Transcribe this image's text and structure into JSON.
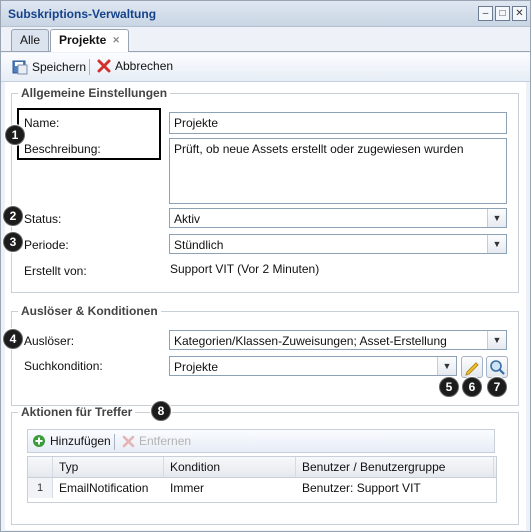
{
  "window": {
    "title": "Subskriptions-Verwaltung"
  },
  "tabs": [
    {
      "label": "Alle"
    },
    {
      "label": "Projekte"
    }
  ],
  "toolbar": {
    "save_label": "Speichern",
    "cancel_label": "Abbrechen"
  },
  "general": {
    "legend": "Allgemeine Einstellungen",
    "name_label": "Name:",
    "name_value": "Projekte",
    "desc_label": "Beschreibung:",
    "desc_value": "Prüft, ob neue Assets erstellt oder zugewiesen wurden",
    "status_label": "Status:",
    "status_value": "Aktiv",
    "period_label": "Periode:",
    "period_value": "Stündlich",
    "created_label": "Erstellt von:",
    "created_value": "Support VIT (Vor 2 Minuten)"
  },
  "triggers": {
    "legend": "Auslöser & Konditionen",
    "trigger_label": "Auslöser:",
    "trigger_value": "Kategorien/Klassen-Zuweisungen; Asset-Erstellung",
    "search_label": "Suchkondition:",
    "search_value": "Projekte"
  },
  "actions": {
    "legend": "Aktionen für Treffer",
    "add_label": "Hinzufügen",
    "remove_label": "Entfernen",
    "columns": [
      "Typ",
      "Kondition",
      "Benutzer / Benutzergruppe"
    ],
    "rows": [
      {
        "num": "1",
        "typ": "EmailNotification",
        "kondition": "Immer",
        "benutzer": "Benutzer: Support VIT"
      }
    ]
  },
  "callouts": [
    "1",
    "2",
    "3",
    "4",
    "5",
    "6",
    "7",
    "8"
  ],
  "colors": {
    "title": "#15428b",
    "callout": "#1c1c1c",
    "cancel": "#d0312d",
    "add": "#3a9d3a"
  }
}
